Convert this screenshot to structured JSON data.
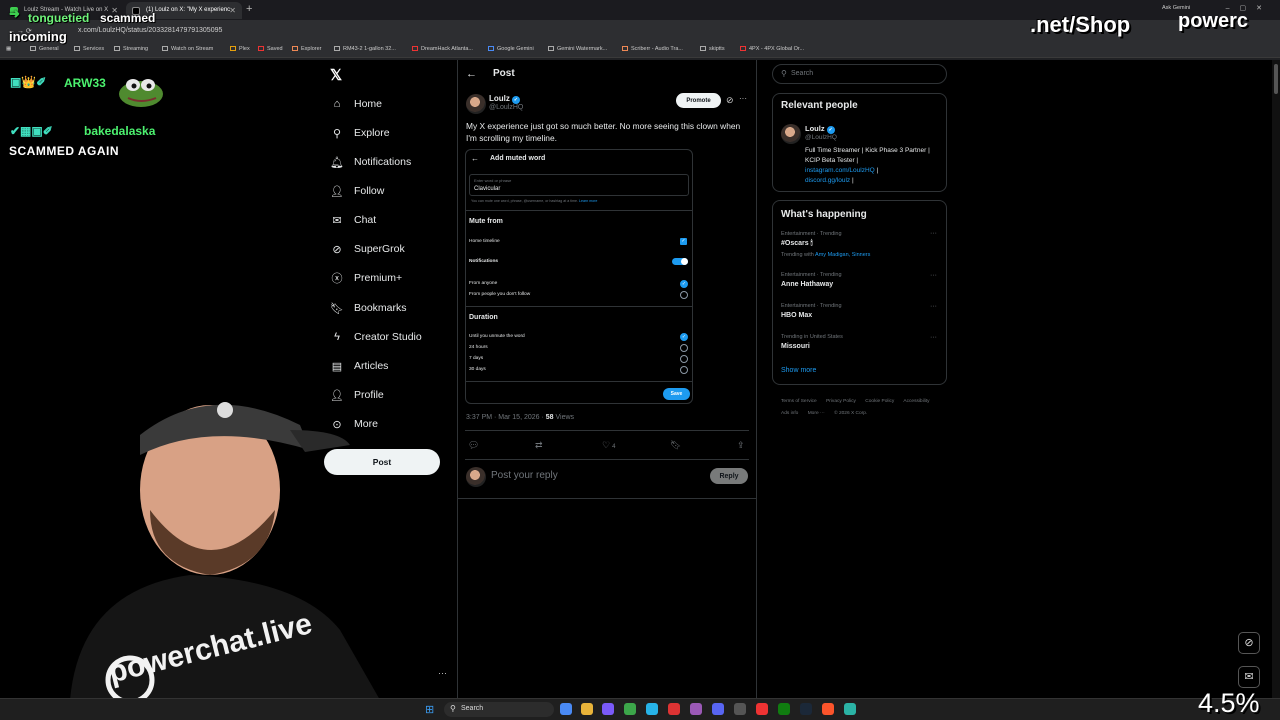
{
  "browser": {
    "tabs": [
      {
        "label": "Loulz Stream - Watch Live on X"
      },
      {
        "label": "(1) Loulz on X: \"My X experienc"
      }
    ],
    "url": "x.com/LoulzHQ/status/2033281479791305095",
    "bookmarks": [
      "General",
      "Services",
      "Streaming",
      "Watch on Stream",
      "Plex",
      "Saved",
      "Explorer",
      "RM43-2 1-gallon 32...",
      "DreamHack Atlanta...",
      "Google Gemini",
      "Gemini Watermark...",
      "Scriberr - Audio Tra...",
      "skiptts",
      "4PX - 4PX Global Or..."
    ],
    "ask_label": "Ask Gemini"
  },
  "overlay": {
    "chat_line1_user": "tonguetied",
    "chat_line1_msg": "scammed",
    "chat_line2": "incoming",
    "chat_user_a": "ARW33",
    "chat_user_b": "bakedalaska",
    "chat_msg_b": "SCAMMED AGAIN",
    "brand_shop": ".net/Shop",
    "brand_name": "powerc",
    "percent": "4.5%"
  },
  "sidebar": {
    "items": [
      {
        "label": "Home",
        "icon": "home-icon"
      },
      {
        "label": "Explore",
        "icon": "search-icon"
      },
      {
        "label": "Notifications",
        "icon": "bell-icon"
      },
      {
        "label": "Follow",
        "icon": "person-add-icon"
      },
      {
        "label": "Chat",
        "icon": "mail-icon"
      },
      {
        "label": "SuperGrok",
        "icon": "grok-icon"
      },
      {
        "label": "Premium+",
        "icon": "x-circle-icon"
      },
      {
        "label": "Bookmarks",
        "icon": "bookmark-icon"
      },
      {
        "label": "Creator Studio",
        "icon": "lightning-icon"
      },
      {
        "label": "Articles",
        "icon": "document-icon"
      },
      {
        "label": "Profile",
        "icon": "person-icon"
      },
      {
        "label": "More",
        "icon": "more-circle-icon"
      }
    ],
    "post_button": "Post"
  },
  "post": {
    "header_title": "Post",
    "author_name": "Loulz",
    "author_handle": "@LoulzHQ",
    "promote_label": "Promote",
    "text": "My X experience just got so much better. No more seeing this clown when I'm scrolling my timeline.",
    "timestamp": "3:37 PM · Mar 15, 2026 · ",
    "views_count": "58",
    "views_label": " Views",
    "likes": "4",
    "reply_placeholder": "Post your reply",
    "reply_button": "Reply"
  },
  "embed": {
    "title": "Add muted word",
    "input_label": "Enter word or phrase",
    "input_value": "Clavicular",
    "hint": "You can mute one word, phrase, @username, or hashtag at a time. ",
    "hint_link": "Learn more",
    "mute_from_title": "Mute from",
    "home_timeline": "Home timeline",
    "notifications": "Notifications",
    "from_anyone": "From anyone",
    "from_not_follow": "From people you don't follow",
    "duration_title": "Duration",
    "until_unmute": "Until you unmute the word",
    "hours24": "24 hours",
    "days7": "7 days",
    "days30": "30 days",
    "save": "Save"
  },
  "right": {
    "search_placeholder": "Search",
    "relevant_title": "Relevant people",
    "rp_name": "Loulz",
    "rp_handle": "@LoulzHQ",
    "rp_bio": "Full Time Streamer | Kick Phase 3 Partner | KCIP Beta Tester |",
    "rp_link1": "instagram.com/LoulzHQ",
    "rp_link2": "discord.gg/loulz",
    "happening_title": "What's happening",
    "trends": [
      {
        "category": "Entertainment · Trending",
        "name": "#Oscars 🕯",
        "sub_prefix": "Trending with ",
        "sub_link": "Amy Madigan, Sinners"
      },
      {
        "category": "Entertainment · Trending",
        "name": "Anne Hathaway"
      },
      {
        "category": "Entertainment · Trending",
        "name": "HBO Max"
      },
      {
        "category": "Trending in United States",
        "name": "Missouri"
      }
    ],
    "show_more": "Show more",
    "footer": [
      "Terms of Service",
      "Privacy Policy",
      "Cookie Policy",
      "Accessibility",
      "Ads info",
      "More ···",
      "© 2026 X Corp."
    ]
  },
  "taskbar": {
    "search_label": "Search"
  },
  "colors": {
    "accent": "#1d9bf0",
    "background": "#000000",
    "chat_green": "#4cf26f"
  }
}
